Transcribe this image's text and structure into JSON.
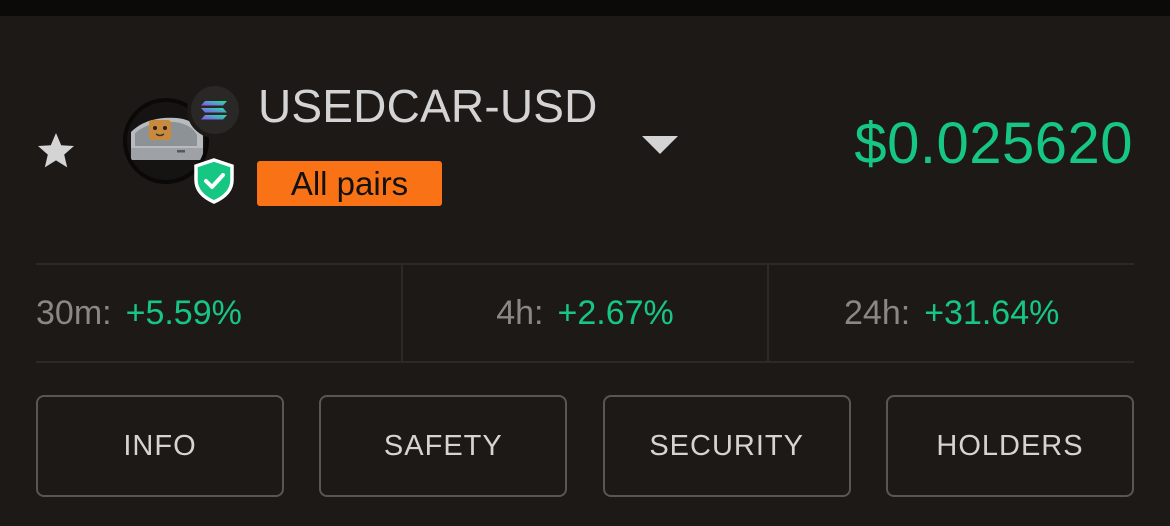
{
  "token": {
    "pair_name": "USEDCAR-USD",
    "pairs_badge": "All pairs",
    "price": "$0.025620",
    "chain_icon": "solana-icon",
    "verified_icon": "shield-check-icon"
  },
  "stats": [
    {
      "label": "30m:",
      "value": "+5.59%"
    },
    {
      "label": "4h:",
      "value": "+2.67%"
    },
    {
      "label": "24h:",
      "value": "+31.64%"
    }
  ],
  "buttons": {
    "info": "INFO",
    "safety": "SAFETY",
    "security": "SECURITY",
    "holders": "HOLDERS"
  },
  "colors": {
    "background": "#1c1917",
    "positive": "#16c784",
    "badge": "#f97316",
    "verified": "#16c784"
  }
}
